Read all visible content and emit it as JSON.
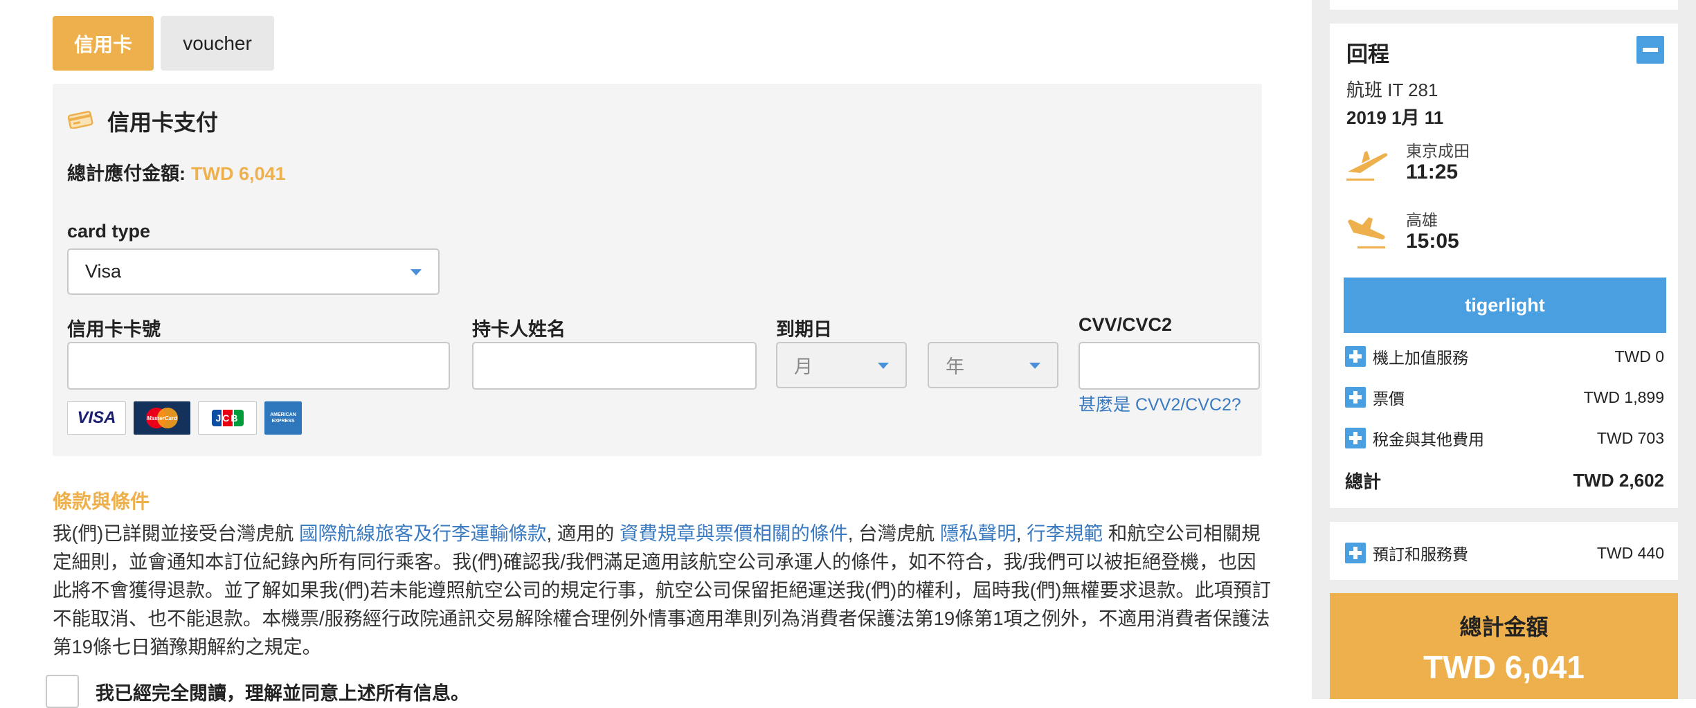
{
  "payment_tabs": {
    "credit_card": "信用卡",
    "voucher": "voucher"
  },
  "card_panel": {
    "title": "信用卡支付",
    "total_label": "總計應付金額:",
    "total_amount": "TWD 6,041",
    "card_type_label": "card type",
    "card_type_value": "Visa",
    "card_number_label": "信用卡卡號",
    "cardholder_label": "持卡人姓名",
    "expiry_label": "到期日",
    "month_placeholder": "月",
    "year_placeholder": "年",
    "cvv_label": "CVV/CVC2",
    "cvv_help": "甚麼是 CVV2/CVC2?",
    "card_logos": {
      "visa": "VISA",
      "mastercard": "MasterCard",
      "jcb": "JCB",
      "amex": "AMERICAN EXPRESS"
    }
  },
  "terms": {
    "title": "條款與條件",
    "p1": "我(們)已詳閱並接受台灣虎航 ",
    "link1": "國際航線旅客及行李運輸條款",
    "p2": ", 適用的 ",
    "link2": "資費規章與票價相關的條件",
    "p3": ", 台灣虎航 ",
    "link3": "隱私聲明",
    "p4": ", ",
    "link4": "行李規範",
    "p5": " 和航空公司相關規定細則，並會通知本訂位紀錄內所有同行乘客。我(們)確認我/我們滿足適用該航空公司承運人的條件，如不符合，我/我們可以被拒絕登機，也因此將不會獲得退款。並了解如果我(們)若未能遵照航空公司的規定行事，航空公司保留拒絕運送我(們)的權利，屆時我(們)無權要求退款。此項預訂不能取消、也不能退款。本機票/服務經行政院通訊交易解除權合理例外情事適用準則列為消費者保護法第19條第1項之例外，不適用消費者保護法第19條七日猶豫期解約之規定。",
    "agree": "我已經完全閱讀，理解並同意上述所有信息。"
  },
  "sidebar": {
    "return_title": "回程",
    "flight": "航班 IT 281",
    "date": "2019 1月 11",
    "origin": "東京成田",
    "depart_time": "11:25",
    "destination": "高雄",
    "arrive_time": "15:05",
    "fare_name": "tigerlight",
    "items": [
      {
        "label": "機上加值服務",
        "value": "TWD 0"
      },
      {
        "label": "票價",
        "value": "TWD 1,899"
      },
      {
        "label": "稅金與其他費用",
        "value": "TWD 703"
      }
    ],
    "subtotal_label": "總計",
    "subtotal_value": "TWD 2,602",
    "booking_fee_label": "預訂和服務費",
    "booking_fee_value": "TWD 440",
    "grand_total_label": "總計金額",
    "grand_total_value": "TWD 6,041"
  },
  "colors": {
    "accent": "#EDB04D",
    "blue": "#4A9FE0",
    "link": "#3A7AC0"
  },
  "icons": [
    "card-icon",
    "caret-down-icon",
    "plane-takeoff-icon",
    "plane-landing-icon",
    "plus-icon",
    "minus-icon"
  ]
}
